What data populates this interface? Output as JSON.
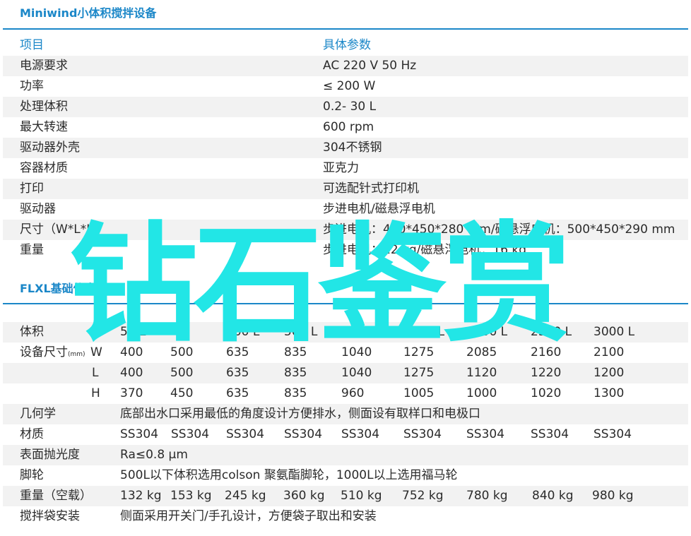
{
  "section1": {
    "title": "Miniwind小体积搅拌设备",
    "header": {
      "name": "项目",
      "value": "具体参数"
    },
    "rows": [
      {
        "name": "电源要求",
        "value": "AC 220 V 50 Hz"
      },
      {
        "name": "功率",
        "value": "≤ 200 W"
      },
      {
        "name": "处理体积",
        "value": "0.2- 30 L"
      },
      {
        "name": "最大转速",
        "value": "600 rpm"
      },
      {
        "name": "驱动器外壳",
        "value": "304不锈钢"
      },
      {
        "name": "容器材质",
        "value": "亚克力"
      },
      {
        "name": "打印",
        "value": "可选配针式打印机"
      },
      {
        "name": "驱动器",
        "value": "步进电机/磁悬浮电机"
      },
      {
        "name": "尺寸（W*L*H",
        "value": "步进电机：450*450*280 mm/磁悬浮电机：500*450*290 mm"
      },
      {
        "name": "重量",
        "value": "步进电机：12 kg/磁悬浮电机：16 kg"
      }
    ]
  },
  "section2": {
    "title": "FLXL基础信息",
    "volume": {
      "label": "体积",
      "values": [
        "50 L",
        "200 L",
        "500 L",
        "1000 L",
        "1500 L",
        "2000 L",
        "2500 L",
        "3000 L"
      ]
    },
    "size": {
      "label": "设备尺寸",
      "unit": "(mm)",
      "rows": [
        {
          "axis": "W",
          "values": [
            "400",
            "500",
            "635",
            "835",
            "1040",
            "1275",
            "2085",
            "2160",
            "2100"
          ]
        },
        {
          "axis": "L",
          "values": [
            "400",
            "500",
            "635",
            "835",
            "1040",
            "1275",
            "1120",
            "1220",
            "1200"
          ]
        },
        {
          "axis": "H",
          "values": [
            "370",
            "450",
            "635",
            "835",
            "960",
            "1005",
            "1000",
            "1020",
            "1300"
          ]
        }
      ]
    },
    "geometry": {
      "label": "几何学",
      "value": "底部出水口采用最低的角度设计方便排水，侧面设有取样口和电极口"
    },
    "material": {
      "label": "材质",
      "values": [
        "SS304",
        "SS304",
        "SS304",
        "SS304",
        "SS304",
        "SS304",
        "SS304",
        "SS304",
        "SS304"
      ]
    },
    "polish": {
      "label": "表面抛光度",
      "value": "Ra≤0.8 μm"
    },
    "wheels": {
      "label": "脚轮",
      "value": "500L以下体积选用colson 聚氨酯脚轮，1000L以上选用福马轮"
    },
    "weight": {
      "label": "重量（空载）",
      "values": [
        "132 kg",
        "153 kg",
        "245 kg",
        "360 kg",
        "510 kg",
        "752 kg",
        "780 kg",
        "840 kg",
        "980 kg"
      ]
    },
    "bag": {
      "label": "搅拌袋安装",
      "value": "侧面采用开关门/手孔设计，方便袋子取出和安装"
    }
  },
  "watermark": {
    "text": "钻石鉴赏",
    "color": "#22e6e6"
  },
  "colors": {
    "accent": "#1b87c8",
    "row_shade": "#f2f2f2",
    "text": "#2b2b2b"
  }
}
